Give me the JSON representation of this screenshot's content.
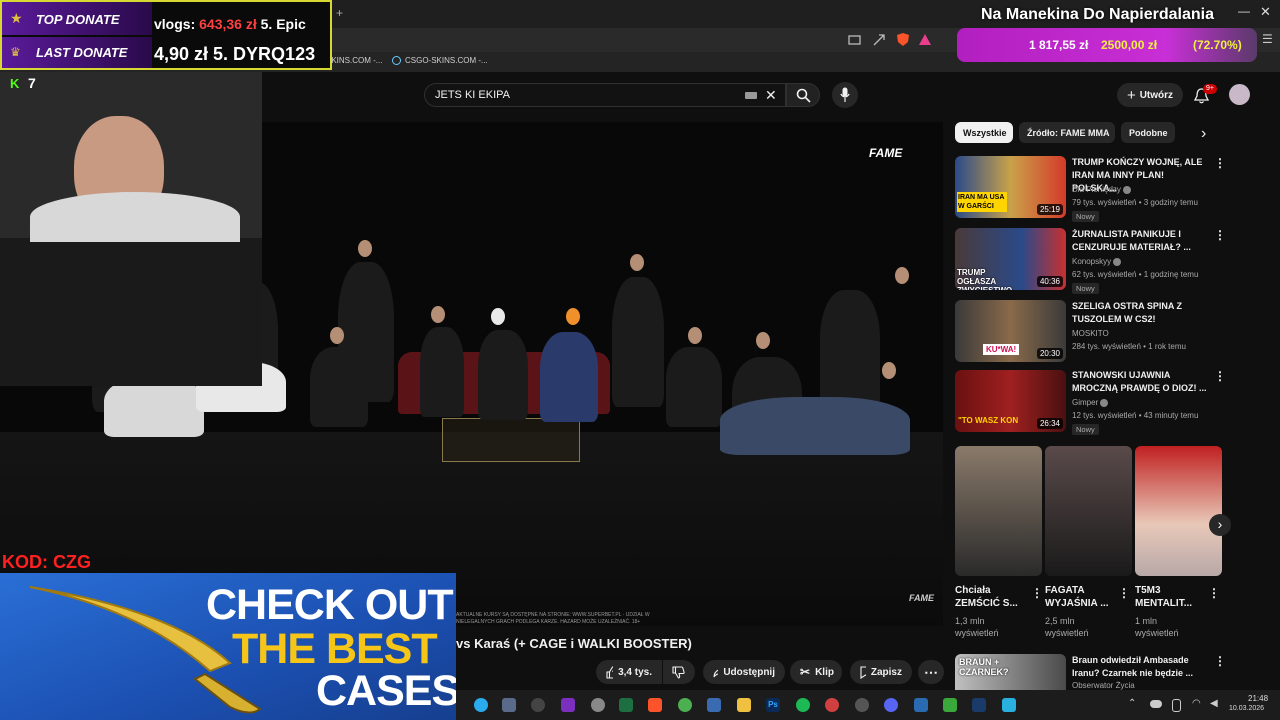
{
  "overlay": {
    "top_donate_label": "TOP DONATE",
    "top_donate_ticker": "vlogs: 643,36 zł   5. Epic",
    "top_donate_amount": "643,36 zł",
    "last_donate_label": "LAST DONATE",
    "last_donate_ticker": "4,90 zł 5. DYRQ123",
    "kick_count": "7",
    "code_label": "KOD: CZG",
    "promo_line1": "CHECK OUT",
    "promo_line2": "THE BEST",
    "promo_line3": "CASES",
    "goal_title": "Na Manekina Do Napierdalania",
    "goal_current": "1 817,55 zł",
    "goal_target": "2500,00 zł",
    "goal_percent_text": "(72.70%)",
    "goal_percent": 72.7
  },
  "browser": {
    "bookmark1": "SKINS.COM -...",
    "bookmark2": "CSGO-SKINS.COM -..."
  },
  "header": {
    "search_value": "JETS KI EKIPA",
    "create_label": "Utwórz",
    "notif_count": "9+"
  },
  "video": {
    "watermark": "FAME",
    "watermark_small": "FAME",
    "disclaimer": "AKTUALNE KURSY SĄ DOSTĘPNE NA STRONIE: WWW.SUPERBET.PL · UDZIAŁ W NIELEGALNYCH GRACH PODLEGA KARZE. HAZARD MOŻE UZALEŻNIAĆ. 18+",
    "title": "vs Karaś (+ CAGE i WALKI BOOSTER)",
    "likes": "3,4 tys.",
    "share": "Udostępnij",
    "clip": "Klip",
    "save": "Zapisz"
  },
  "chips": [
    "Wszystkie",
    "Źródło: FAME MMA",
    "Podobne"
  ],
  "recommended": [
    {
      "title": "TRUMP KOŃCZY WOJNĘ, ALE IRAN MA INNY PLAN! POLSKA...",
      "channel": "Dla Pieniędzy",
      "meta": "79 tys. wyświetleń • 3 godziny temu",
      "badge": "Nowy",
      "duration": "25:19",
      "thumb_text": "IRAN MA USA W GARŚCI"
    },
    {
      "title": "ŻURNALISTA PANIKUJE I CENZURUJE MATERIAŁ? ...",
      "channel": "Konopskyy",
      "meta": "62 tys. wyświetleń • 1 godzinę temu",
      "badge": "Nowy",
      "duration": "40:36",
      "thumb_text": "TRUMP OGŁASZA ZWYCIĘSTWO"
    },
    {
      "title": "SZELIGA OSTRA SPINA Z TUSZOLEM W CS2!",
      "channel": "MOSKITO",
      "meta": "284 tys. wyświetleń • 1 rok temu",
      "badge": "",
      "duration": "20:30",
      "thumb_text": "KU*WA!"
    },
    {
      "title": "STANOWSKI UJAWNIA MROCZNĄ PRAWDĘ O DIOZ! ...",
      "channel": "Gimper",
      "meta": "12 tys. wyświetleń • 43 minuty temu",
      "badge": "Nowy",
      "duration": "26:34",
      "thumb_text": "\"TO WASZ KON"
    }
  ],
  "shorts": [
    {
      "title": "Chciała ZEMŚCIĆ S...",
      "views1": "1,3 mln",
      "views2": "wyświetleń"
    },
    {
      "title": "FAGATA WYJAŚNIA ...",
      "views1": "2,5 mln",
      "views2": "wyświetleń"
    },
    {
      "title": "T5M3 MENTALIT...",
      "views1": "1 mln",
      "views2": "wyświetleń"
    }
  ],
  "next_video": {
    "title": "Braun odwiedził Ambasade Iranu? Czarnek nie będzie ...",
    "channel": "Obserwator Życia",
    "thumb_text": "BRAUN + CZARNEK?"
  },
  "taskbar": {
    "time": "21:48",
    "date": "10.03.2026"
  },
  "colors": {
    "accent_yellow": "#d8d832",
    "goal_magenta": "#c82fd6",
    "yt_red": "#ff0000",
    "kick_green": "#53fc18"
  }
}
